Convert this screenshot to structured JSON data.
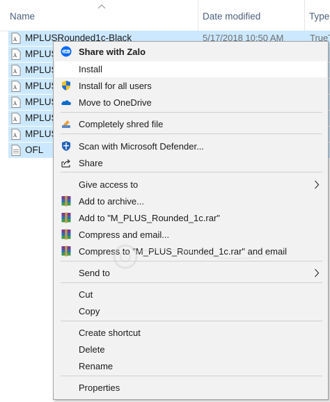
{
  "columns": {
    "name": "Name",
    "date_modified": "Date modified",
    "type": "Type"
  },
  "files": [
    {
      "name": "MPLUSRounded1c-Black",
      "date": "5/17/2018 10:50 AM",
      "type": "TrueT",
      "selected": true
    },
    {
      "name": "MPLUS",
      "date": "",
      "type": "",
      "selected": true
    },
    {
      "name": "MPLUS",
      "date": "",
      "type": "",
      "selected": true
    },
    {
      "name": "MPLUS",
      "date": "",
      "type": "",
      "selected": true
    },
    {
      "name": "MPLUS",
      "date": "",
      "type": "",
      "selected": true
    },
    {
      "name": "MPLUS",
      "date": "",
      "type": "",
      "selected": true
    },
    {
      "name": "MPLUS",
      "date": "",
      "type": "",
      "selected": true
    },
    {
      "name": "OFL",
      "date": "",
      "type": "",
      "selected": true
    }
  ],
  "context_menu": {
    "share_zalo": "Share with Zalo",
    "install": "Install",
    "install_all": "Install for all users",
    "onedrive": "Move to OneDrive",
    "shred": "Completely shred file",
    "defender": "Scan with Microsoft Defender...",
    "share": "Share",
    "give_access": "Give access to",
    "add_archive": "Add to archive...",
    "add_rar": "Add to \"M_PLUS_Rounded_1c.rar\"",
    "compress_email": "Compress and email...",
    "compress_rar_email": "Compress to \"M_PLUS_Rounded_1c.rar\" and email",
    "send_to": "Send to",
    "cut": "Cut",
    "copy": "Copy",
    "create_shortcut": "Create shortcut",
    "delete": "Delete",
    "rename": "Rename",
    "properties": "Properties"
  },
  "icons": {
    "zalo": "zalo-icon",
    "shield": "uac-shield-icon",
    "onedrive": "onedrive-cloud-icon",
    "shred": "shred-icon",
    "defender": "defender-icon",
    "share": "share-icon",
    "winrar": "winrar-icon",
    "submenu": "chevron-right-icon",
    "font_file": "font-file-icon",
    "text_file": "text-file-icon"
  },
  "colors": {
    "selection": "#cce8ff",
    "menu_bg": "#f2f2f2",
    "header_text": "#4c607a",
    "zalo_blue": "#0068ff"
  }
}
